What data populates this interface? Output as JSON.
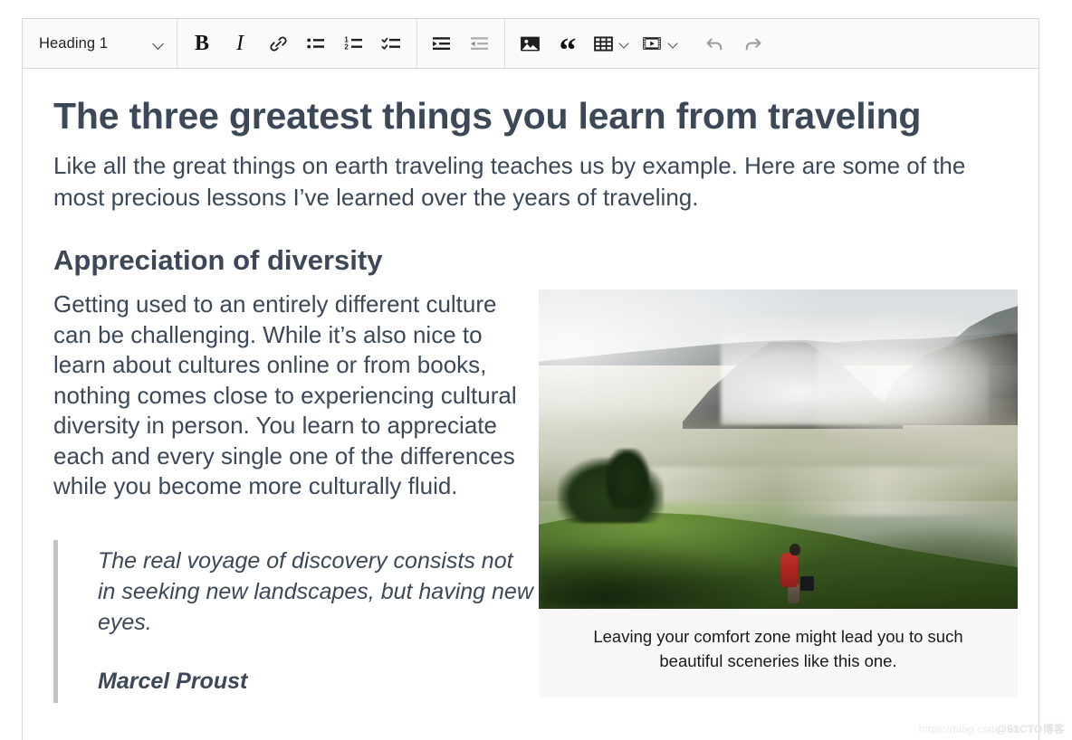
{
  "toolbar": {
    "style_select": {
      "value": "Heading 1",
      "chevron_icon": "chevron-down-icon"
    },
    "buttons": [
      {
        "name": "bold",
        "label": "B",
        "icon": "bold-icon",
        "disabled": false
      },
      {
        "name": "italic",
        "label": "I",
        "icon": "italic-icon",
        "disabled": false
      },
      {
        "name": "link",
        "label": "",
        "icon": "link-icon",
        "disabled": false
      },
      {
        "name": "bulleted-list",
        "label": "",
        "icon": "bulleted-list-icon",
        "disabled": false
      },
      {
        "name": "numbered-list",
        "label": "",
        "icon": "numbered-list-icon",
        "disabled": false
      },
      {
        "name": "todo-list",
        "label": "",
        "icon": "checklist-icon",
        "disabled": false
      },
      {
        "name": "increase-indent",
        "label": "",
        "icon": "indent-increase-icon",
        "disabled": false
      },
      {
        "name": "decrease-indent",
        "label": "",
        "icon": "indent-decrease-icon",
        "disabled": true
      },
      {
        "name": "insert-image",
        "label": "",
        "icon": "image-icon",
        "disabled": false
      },
      {
        "name": "block-quote",
        "label": "“",
        "icon": "quote-icon",
        "disabled": false
      },
      {
        "name": "insert-table",
        "label": "",
        "icon": "table-icon",
        "disabled": false
      },
      {
        "name": "insert-media",
        "label": "",
        "icon": "media-icon",
        "disabled": false
      },
      {
        "name": "undo",
        "label": "",
        "icon": "undo-icon",
        "disabled": true
      },
      {
        "name": "redo",
        "label": "",
        "icon": "redo-icon",
        "disabled": true
      }
    ]
  },
  "document": {
    "title": "The three greatest things you learn from traveling",
    "lead": "Like all the great things on earth traveling teaches us by example. Here are some of the most precious lessons I’ve learned over the years of traveling.",
    "section_heading": "Appreciation of diversity",
    "body_paragraph": "Getting used to an entirely different culture can be challenging. While it’s also nice to learn about cultures online or from books, nothing comes close to experiencing cultural diversity in person. You learn to appreciate each and every single one of the differences while you become more culturally fluid.",
    "quote": {
      "text": "The real voyage of discovery consists not in seeking new landscapes, but having new eyes.",
      "author": "Marcel Proust"
    },
    "figure": {
      "alt": "Person in a red jacket standing in tall grass overlooking a smoking volcano crater",
      "caption": "Leaving your comfort zone might lead you to such beautiful sceneries like this one."
    }
  },
  "watermark": {
    "url": "https://blog.csdn.net",
    "badge": "@51CTO博客"
  },
  "colors": {
    "text": "#3c4858",
    "toolbar_bg": "#fafafa",
    "border": "#d8d8d8",
    "caption_bg": "#f8f8f8",
    "quote_bar": "#c3c3c3"
  }
}
